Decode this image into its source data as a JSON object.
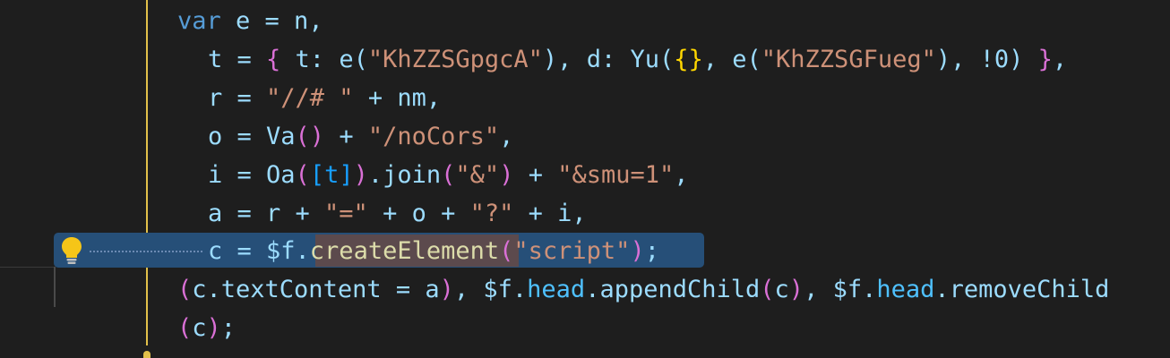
{
  "editor": {
    "accent_guide_color": "#e2c04a",
    "selection_color": "#264f78",
    "lines": [
      {
        "t1": "var",
        "t2": " e = n,"
      },
      {
        "t1": "t = ",
        "b1": "{",
        "t2": " t: e(",
        "s1": "\"KhZZSGpgcA\"",
        "t3": "), d: Yu(",
        "b2": "{}",
        "t4": ", e(",
        "s2": "\"KhZZSGFueg\"",
        "t5": "), !0) ",
        "b3": "}",
        "t6": ","
      },
      {
        "t1": "r = ",
        "s1": "\"//# \"",
        "t2": " + nm,"
      },
      {
        "t1": "o = Va",
        "b1": "()",
        "t2": " + ",
        "s1": "\"/noCors\"",
        "t3": ","
      },
      {
        "t1": "i = Oa",
        "b1": "(",
        "b2": "[t]",
        "b3": ")",
        "t2": ".join",
        "b4": "(",
        "s1": "\"&\"",
        "b5": ")",
        "t3": " + ",
        "s2": "\"&smu=1\"",
        "t4": ","
      },
      {
        "t1": "a = r + ",
        "s1": "\"=\"",
        "t2": " + o + ",
        "s2": "\"?\"",
        "t3": " + i,"
      },
      {
        "t1": "c = $f.",
        "f1": "createElement",
        "b1": "(",
        "s1": "\"script\"",
        "b2": ")",
        "t2": ";"
      },
      {
        "b1": "(",
        "t1": "c.textContent = a",
        "b2": ")",
        "t2": ", $f.",
        "p1": "head",
        "t3": ".appendChild",
        "b3": "(",
        "t4": "c",
        "b4": ")",
        "t5": ", $f.",
        "p2": "head",
        "t6": ".removeChild"
      },
      {
        "b1": "(",
        "t1": "c",
        "b2": ")",
        "t2": ";"
      }
    ]
  }
}
